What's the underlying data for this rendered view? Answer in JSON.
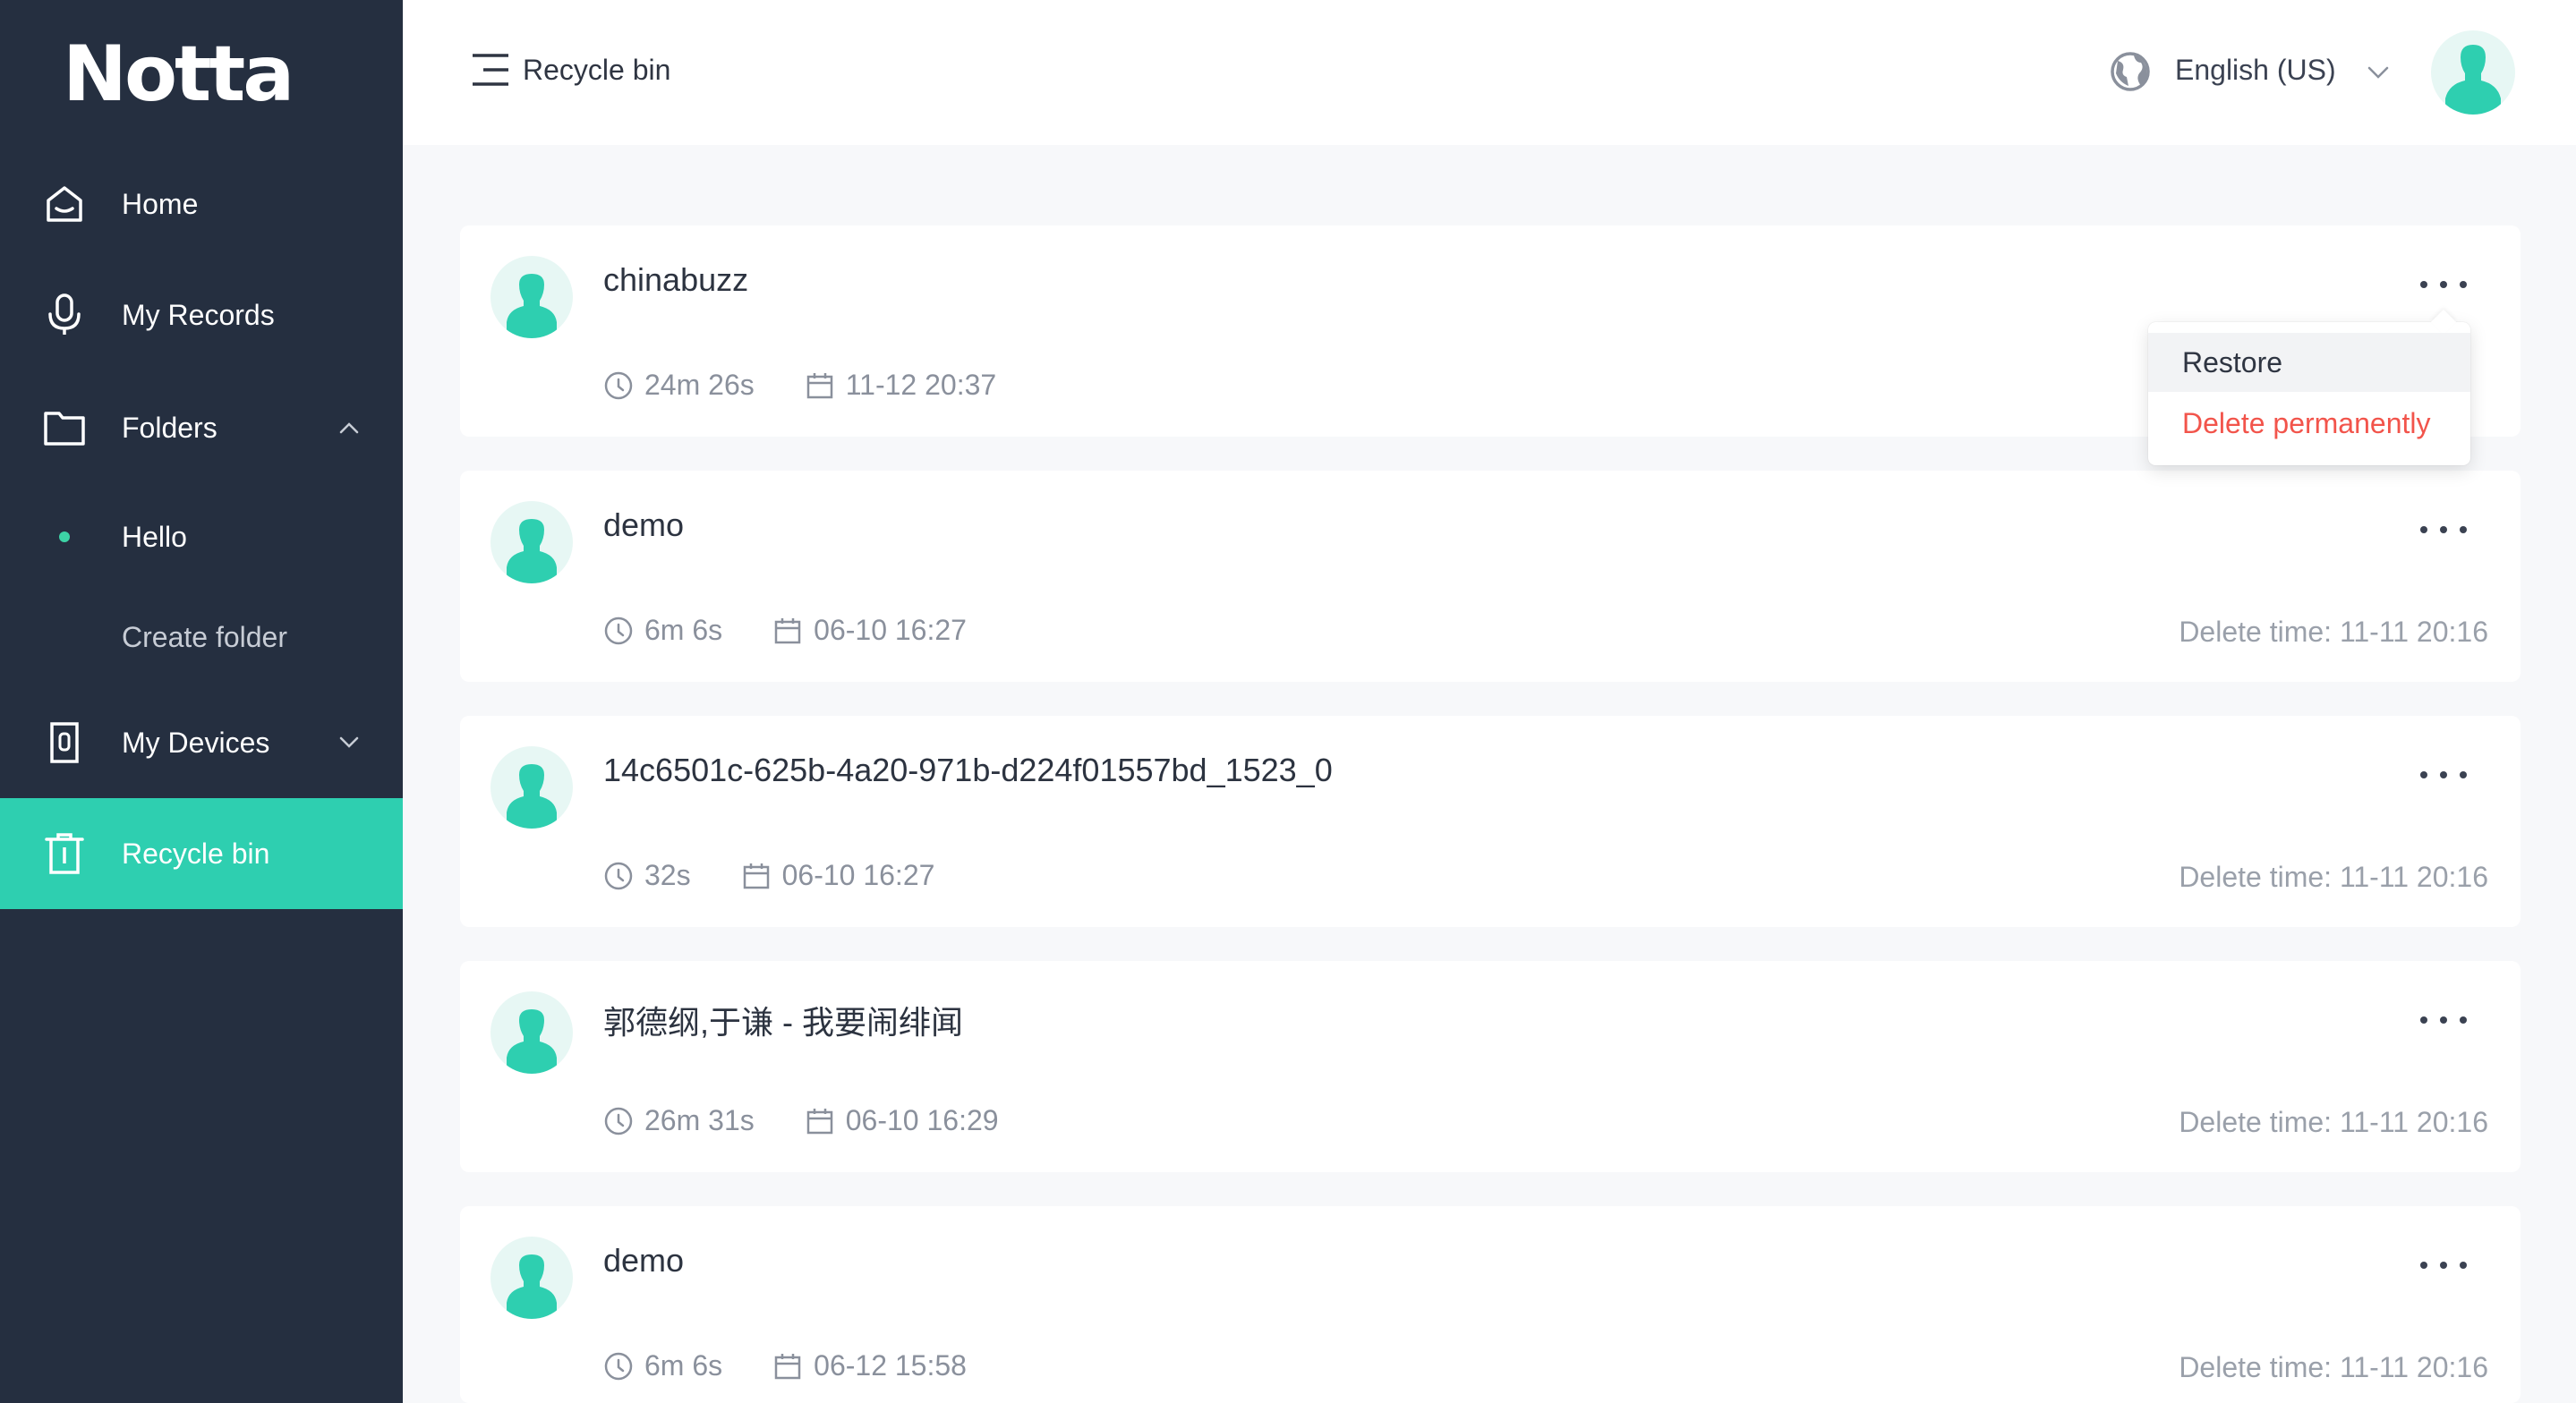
{
  "brand": {
    "logo_text": "Notta"
  },
  "sidebar": {
    "items": [
      {
        "label": "Home",
        "icon": "home-icon"
      },
      {
        "label": "My Records",
        "icon": "microphone-icon"
      },
      {
        "label": "Folders",
        "icon": "folder-icon",
        "expanded": true
      },
      {
        "label": "Hello",
        "icon": "dot-icon"
      },
      {
        "label": "Create folder"
      },
      {
        "label": "My Devices",
        "icon": "device-icon",
        "expanded": false
      },
      {
        "label": "Recycle bin",
        "icon": "trash-icon",
        "active": true
      }
    ]
  },
  "header": {
    "title": "Recycle bin",
    "language": "English (US)"
  },
  "records": [
    {
      "title": "chinabuzz",
      "duration": "24m 26s",
      "date": "11-12 20:37",
      "delete_time": ""
    },
    {
      "title": "demo",
      "duration": "6m 6s",
      "date": "06-10 16:27",
      "delete_time": "Delete time: 11-11 20:16"
    },
    {
      "title": "14c6501c-625b-4a20-971b-d224f01557bd_1523_0",
      "duration": "32s",
      "date": "06-10 16:27",
      "delete_time": "Delete time: 11-11 20:16"
    },
    {
      "title": "郭德纲,于谦 - 我要闹绯闻",
      "duration": "26m 31s",
      "date": "06-10 16:29",
      "delete_time": "Delete time: 11-11 20:16"
    },
    {
      "title": "demo",
      "duration": "6m 6s",
      "date": "06-12 15:58",
      "delete_time": "Delete time: 11-11 20:16"
    }
  ],
  "dropdown": {
    "restore": "Restore",
    "delete_permanently": "Delete permanently"
  },
  "colors": {
    "sidebar_bg": "#252f40",
    "accent": "#2ecfb0",
    "danger": "#f2544b"
  }
}
